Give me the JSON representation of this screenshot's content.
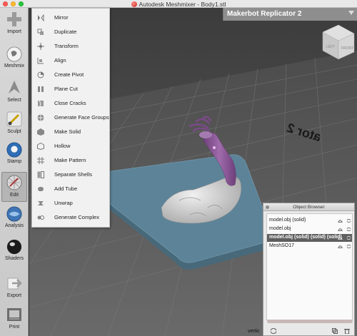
{
  "window": {
    "title": "Autodesk Meshmixer - Body1.stl"
  },
  "toolbar": {
    "items": [
      {
        "label": "Import",
        "icon": "plus-icon"
      },
      {
        "label": "Meshmix",
        "icon": "meshmix-ball-icon"
      },
      {
        "label": "Select",
        "icon": "cursor-arrow-icon"
      },
      {
        "label": "Sculpt",
        "icon": "brush-icon"
      },
      {
        "label": "Stamp",
        "icon": "stamp-ball-icon"
      },
      {
        "label": "Edit",
        "icon": "edit-mesh-icon",
        "active": true
      },
      {
        "label": "Analysis",
        "icon": "analysis-ball-icon"
      },
      {
        "label": "Shaders",
        "icon": "shader-ball-icon"
      },
      {
        "label": "Export",
        "icon": "export-arrow-icon"
      },
      {
        "label": "Print",
        "icon": "printer-icon"
      }
    ]
  },
  "edit_menu": {
    "items": [
      {
        "label": "Mirror",
        "icon": "mirror-icon"
      },
      {
        "label": "Duplicate",
        "icon": "duplicate-icon"
      },
      {
        "label": "Transform",
        "icon": "transform-icon"
      },
      {
        "label": "Align",
        "icon": "align-icon"
      },
      {
        "label": "Create Pivot",
        "icon": "pivot-icon"
      },
      {
        "label": "Plane Cut",
        "icon": "plane-cut-icon"
      },
      {
        "label": "Close Cracks",
        "icon": "close-cracks-icon"
      },
      {
        "label": "Generate Face Groups",
        "icon": "face-groups-icon"
      },
      {
        "label": "Make Solid",
        "icon": "make-solid-icon"
      },
      {
        "label": "Hollow",
        "icon": "hollow-icon"
      },
      {
        "label": "Make Pattern",
        "icon": "pattern-icon"
      },
      {
        "label": "Separate Shells",
        "icon": "separate-shells-icon"
      },
      {
        "label": "Add Tube",
        "icon": "tube-icon"
      },
      {
        "label": "Unwrap",
        "icon": "unwrap-icon"
      },
      {
        "label": "Generate Complex",
        "icon": "complex-icon"
      }
    ]
  },
  "printer": {
    "name": "Makerbot Replicator 2"
  },
  "viewcube": {
    "left_label": "LEFT",
    "front_label": "FRONT"
  },
  "bed_text": "ator 2",
  "object_browser": {
    "title": "Object Browser",
    "objects": [
      {
        "name": "model.obj (solid)",
        "selected": false
      },
      {
        "name": "model.obj",
        "selected": false
      },
      {
        "name": "model.obj (solid) (solid) (solid)",
        "selected": true
      },
      {
        "name": "MeshSO17",
        "selected": false
      }
    ]
  },
  "status": {
    "vertices_label": "vertic"
  },
  "colors": {
    "bed": "#5d8398",
    "model_body": "#d5d5d5",
    "model_arm": "#8e5a98",
    "menu_bg": "#f1f1f1",
    "selected_row": "#5f5f5f"
  }
}
